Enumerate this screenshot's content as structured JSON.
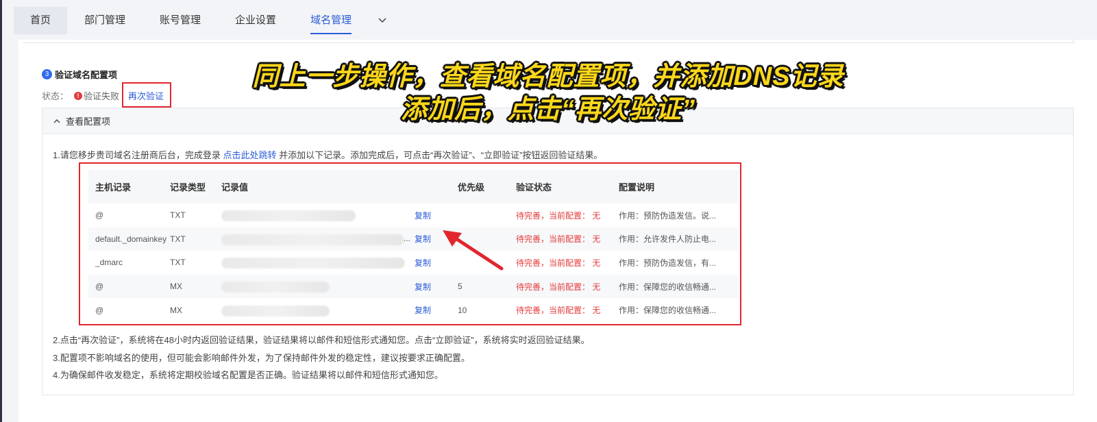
{
  "nav": {
    "tabs": [
      "首页",
      "部门管理",
      "账号管理",
      "企业设置",
      "域名管理"
    ],
    "active": "域名管理"
  },
  "step": {
    "number": "3",
    "title": "验证域名配置项"
  },
  "status": {
    "label": "状态：",
    "icon": "!",
    "value": "验证失败",
    "action": "再次验证"
  },
  "panel": {
    "toggle": "查看配置项",
    "intro_before": "1.请您移步贵司域名注册商后台，完成登录 ",
    "intro_link": "点击此处跳转",
    "intro_after": " 并添加以下记录。添加完成后，可点击“再次验证”、“立即验证”按钮返回验证结果。"
  },
  "table": {
    "headers": [
      "主机记录",
      "记录类型",
      "记录值",
      "优先级",
      "验证状态",
      "配置说明"
    ],
    "copy_label": "复制",
    "rows": [
      {
        "host": "@",
        "type": "TXT",
        "priority": "",
        "status": "待完善，当前配置： 无",
        "desc": "作用：预防伪造发信。说..."
      },
      {
        "host": "default._domainkey",
        "type": "TXT",
        "priority": "",
        "status": "待完善，当前配置： 无",
        "desc": "作用：允许发件人防止电..."
      },
      {
        "host": "_dmarc",
        "type": "TXT",
        "priority": "",
        "status": "待完善，当前配置： 无",
        "desc": "作用：预防伪造发信，有..."
      },
      {
        "host": "@",
        "type": "MX",
        "priority": "5",
        "status": "待完善，当前配置： 无",
        "desc": "作用：保障您的收信畅通..."
      },
      {
        "host": "@",
        "type": "MX",
        "priority": "10",
        "status": "待完善，当前配置： 无",
        "desc": "作用：保障您的收信畅通..."
      }
    ]
  },
  "notes": [
    "2.点击“再次验证”，系统将在48小时内返回验证结果，验证结果将以邮件和短信形式通知您。点击“立即验证”，系统将实时返回验证结果。",
    "3.配置项不影响域名的使用，但可能会影响邮件外发，为了保持邮件外发的稳定性，建议按要求正确配置。",
    "4.为确保邮件收发稳定，系统将定期校验域名配置是否正确。验证结果将以邮件和短信形式通知您。"
  ],
  "overlay": {
    "line1": "同上一步操作，查看域名配置项，并添加DNS记录",
    "line2": "添加后，点击“再次验证”"
  },
  "colors": {
    "accent": "#2a5bd7",
    "error": "#e33b3b",
    "highlight": "#e1262d",
    "overlay_text": "#fcd71a"
  }
}
